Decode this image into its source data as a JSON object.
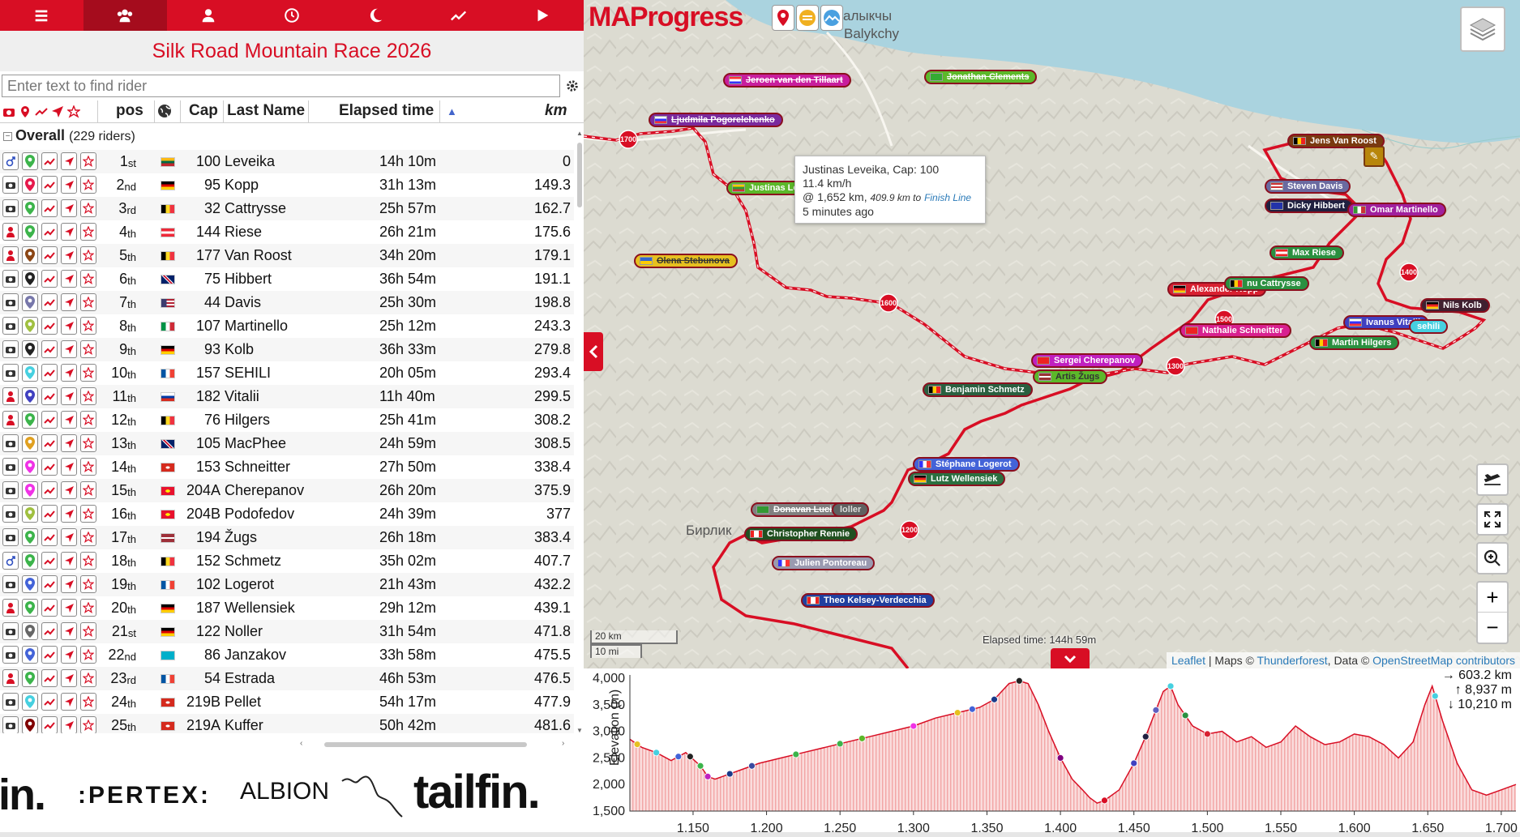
{
  "app": {
    "title": "Silk Road Mountain Race 2026",
    "logo": "MAProgress",
    "accent_color": "#d80e24"
  },
  "nav": [
    {
      "icon": "menu-icon",
      "active": false
    },
    {
      "icon": "group-icon",
      "active": true
    },
    {
      "icon": "user-icon",
      "active": false
    },
    {
      "icon": "clock-icon",
      "active": false
    },
    {
      "icon": "moon-icon",
      "active": false
    },
    {
      "icon": "chart-line-icon",
      "active": false
    },
    {
      "icon": "play-icon",
      "active": false
    }
  ],
  "search": {
    "placeholder": "Enter text to find rider"
  },
  "table": {
    "headers": {
      "pos": "pos",
      "cap": "Cap",
      "last_name": "Last Name",
      "elapsed": "Elapsed time",
      "km": "km"
    },
    "group": {
      "label": "Overall",
      "count": "(229 riders)"
    },
    "rows": [
      {
        "pos": "1",
        "suf": "st",
        "cap": "100",
        "name": "Leveika",
        "elapsed": "14h 10m",
        "km": "0",
        "flag": "lt",
        "type": "bike",
        "pin": "#3cb44b"
      },
      {
        "pos": "2",
        "suf": "nd",
        "cap": "95",
        "name": "Kopp",
        "elapsed": "31h 13m",
        "km": "149.3",
        "flag": "de",
        "type": "camera",
        "pin": "#e6194b"
      },
      {
        "pos": "3",
        "suf": "rd",
        "cap": "32",
        "name": "Cattrysse",
        "elapsed": "25h 57m",
        "km": "162.7",
        "flag": "be",
        "type": "camera",
        "pin": "#3cb44b"
      },
      {
        "pos": "4",
        "suf": "th",
        "cap": "144",
        "name": "Riese",
        "elapsed": "26h 21m",
        "km": "175.6",
        "flag": "at",
        "type": "person",
        "pin": "#3cb44b"
      },
      {
        "pos": "5",
        "suf": "th",
        "cap": "177",
        "name": "Van Roost",
        "elapsed": "34h 20m",
        "km": "179.1",
        "flag": "be",
        "type": "person",
        "pin": "#8b4513"
      },
      {
        "pos": "6",
        "suf": "th",
        "cap": "75",
        "name": "Hibbert",
        "elapsed": "36h 54m",
        "km": "191.1",
        "flag": "gb",
        "type": "camera",
        "pin": "#222222"
      },
      {
        "pos": "7",
        "suf": "th",
        "cap": "44",
        "name": "Davis",
        "elapsed": "25h 30m",
        "km": "198.8",
        "flag": "us",
        "type": "camera",
        "pin": "#7777aa"
      },
      {
        "pos": "8",
        "suf": "th",
        "cap": "107",
        "name": "Martinello",
        "elapsed": "25h 12m",
        "km": "243.3",
        "flag": "it",
        "type": "camera",
        "pin": "#a0c040"
      },
      {
        "pos": "9",
        "suf": "th",
        "cap": "93",
        "name": "Kolb",
        "elapsed": "36h 33m",
        "km": "279.8",
        "flag": "de",
        "type": "camera",
        "pin": "#222222"
      },
      {
        "pos": "10",
        "suf": "th",
        "cap": "157",
        "name": "SEHILI",
        "elapsed": "20h 05m",
        "km": "293.4",
        "flag": "fr",
        "type": "camera",
        "pin": "#46d0e0"
      },
      {
        "pos": "11",
        "suf": "th",
        "cap": "182",
        "name": "Vitalii",
        "elapsed": "11h 40m",
        "km": "299.5",
        "flag": "ru",
        "type": "person",
        "pin": "#4040c0"
      },
      {
        "pos": "12",
        "suf": "th",
        "cap": "76",
        "name": "Hilgers",
        "elapsed": "25h 41m",
        "km": "308.2",
        "flag": "be",
        "type": "person",
        "pin": "#3cb44b"
      },
      {
        "pos": "13",
        "suf": "th",
        "cap": "105",
        "name": "MacPhee",
        "elapsed": "24h 59m",
        "km": "308.5",
        "flag": "gb",
        "type": "camera",
        "pin": "#e0a020"
      },
      {
        "pos": "14",
        "suf": "th",
        "cap": "153",
        "name": "Schneitter",
        "elapsed": "27h 50m",
        "km": "338.4",
        "flag": "ch",
        "type": "camera",
        "pin": "#f032e6"
      },
      {
        "pos": "15",
        "suf": "th",
        "cap": "204A",
        "name": "Cherepanov",
        "elapsed": "26h 20m",
        "km": "375.9",
        "flag": "kg",
        "type": "camera",
        "pin": "#f032e6"
      },
      {
        "pos": "16",
        "suf": "th",
        "cap": "204B",
        "name": "Podofedov",
        "elapsed": "24h 39m",
        "km": "377",
        "flag": "kg",
        "type": "camera",
        "pin": "#a0c040"
      },
      {
        "pos": "17",
        "suf": "th",
        "cap": "194",
        "name": "Žugs",
        "elapsed": "26h 18m",
        "km": "383.4",
        "flag": "lv",
        "type": "camera",
        "pin": "#3cb44b"
      },
      {
        "pos": "18",
        "suf": "th",
        "cap": "152",
        "name": "Schmetz",
        "elapsed": "35h 02m",
        "km": "407.7",
        "flag": "be",
        "type": "bike",
        "pin": "#3cb44b"
      },
      {
        "pos": "19",
        "suf": "th",
        "cap": "102",
        "name": "Logerot",
        "elapsed": "21h 43m",
        "km": "432.2",
        "flag": "fr",
        "type": "camera",
        "pin": "#4363d8"
      },
      {
        "pos": "20",
        "suf": "th",
        "cap": "187",
        "name": "Wellensiek",
        "elapsed": "29h 12m",
        "km": "439.1",
        "flag": "de",
        "type": "person",
        "pin": "#3cb44b"
      },
      {
        "pos": "21",
        "suf": "st",
        "cap": "122",
        "name": "Noller",
        "elapsed": "31h 54m",
        "km": "471.8",
        "flag": "de",
        "type": "camera",
        "pin": "#666666"
      },
      {
        "pos": "22",
        "suf": "nd",
        "cap": "86",
        "name": "Janzakov",
        "elapsed": "33h 58m",
        "km": "475.5",
        "flag": "kz",
        "type": "camera",
        "pin": "#4363d8"
      },
      {
        "pos": "23",
        "suf": "rd",
        "cap": "54",
        "name": "Estrada",
        "elapsed": "46h 53m",
        "km": "476.5",
        "flag": "fr",
        "type": "person",
        "pin": "#3cb44b"
      },
      {
        "pos": "24",
        "suf": "th",
        "cap": "219B",
        "name": "Pellet",
        "elapsed": "54h 17m",
        "km": "477.9",
        "flag": "ch",
        "type": "camera",
        "pin": "#46d0e0"
      },
      {
        "pos": "25",
        "suf": "th",
        "cap": "219A",
        "name": "Kuffer",
        "elapsed": "50h 42m",
        "km": "481.6",
        "flag": "ch",
        "type": "camera",
        "pin": "#800000"
      }
    ]
  },
  "sponsors": [
    "in.",
    ":PERTEX:",
    "ALBION",
    "tailfin."
  ],
  "map": {
    "towns": [
      {
        "name": "Balykchy",
        "sub": "алыкчы"
      },
      {
        "name": "Бирлик"
      }
    ],
    "riders": [
      {
        "name": "Jeroen van den Tillaart",
        "color": "#c81e9e"
      },
      {
        "name": "Jonathan Clements",
        "color": "#5cb82a"
      },
      {
        "name": "Ljudmila Pogorelchenko",
        "color": "#7a2a9e"
      },
      {
        "name": "Justinas Le",
        "color": "#5cb82a"
      },
      {
        "name": "Olena Stebunova",
        "color": "#e6c020"
      },
      {
        "name": "Jens Van Roost",
        "color": "#7a3a10"
      },
      {
        "name": "Steven Davis",
        "color": "#6a6aa0"
      },
      {
        "name": "Dicky Hibbert",
        "color": "#202040"
      },
      {
        "name": "Omar Martinello",
        "color": "#a0209e"
      },
      {
        "name": "Max Riese",
        "color": "#2a9040"
      },
      {
        "name": "Alexander Kopp",
        "color": "#d82030"
      },
      {
        "name": "nu Cattrysse",
        "color": "#2a9040"
      },
      {
        "name": "Nathalie Schneitter",
        "color": "#d82090"
      },
      {
        "name": "Nils Kolb",
        "color": "#402030"
      },
      {
        "name": "Ivanus Vitalii",
        "color": "#4040c0"
      },
      {
        "name": "sehili",
        "color": "#46d0e0"
      },
      {
        "name": "Martin Hilgers",
        "color": "#2a9040"
      },
      {
        "name": "Sergei Cherepanov",
        "color": "#c020c0"
      },
      {
        "name": "Artis Žugs",
        "color": "#5cb82a"
      },
      {
        "name": "Benjamin Schmetz",
        "color": "#2a6040"
      },
      {
        "name": "Stéphane Logerot",
        "color": "#4363d8"
      },
      {
        "name": "Lutz Wellensiek",
        "color": "#2a7040"
      },
      {
        "name": "Donavan Lucio",
        "color": "#808080"
      },
      {
        "name": "loller",
        "color": "#606060"
      },
      {
        "name": "Christopher Rennie",
        "color": "#205020"
      },
      {
        "name": "Julien Pontoreau",
        "color": "#9a9ab0"
      },
      {
        "name": "Theo Kelsey-Verdecchia",
        "color": "#2040a0"
      }
    ],
    "km_markers": [
      "1700",
      "1600",
      "1500",
      "1400",
      "1300",
      "1200"
    ],
    "popup": {
      "line1": "Justinas Leveika, Cap: 100",
      "line2": "11.4 km/h",
      "line3a": "@ 1,652 km,",
      "line3b": "409.9 km to",
      "line3link": "Finish Line",
      "line4": "5 minutes ago"
    },
    "scale": {
      "km": "20 km",
      "mi": "10 mi"
    },
    "elapsed": "Elapsed time: 144h 59m",
    "attribution": {
      "leaflet": "Leaflet",
      "maps": " | Maps © ",
      "thunder": "Thunderforest",
      "data": ", Data © ",
      "osm": "OpenStreetMap contributors"
    }
  },
  "elevation": {
    "ylabel": "Elevation (m)",
    "stats": {
      "distance": "→ 603.2 km",
      "up": "↑ 8,937 m",
      "down": "↓ 10,210 m"
    },
    "yticks": [
      "4,000",
      "3,500",
      "3,000",
      "2,500",
      "2,000",
      "1,500"
    ],
    "xticks": [
      "1,150",
      "1,200",
      "1,250",
      "1,300",
      "1,350",
      "1,400",
      "1,450",
      "1,500",
      "1,550",
      "1,600",
      "1,650",
      "1,700"
    ]
  },
  "chart_data": {
    "type": "area",
    "xlabel": "",
    "ylabel": "Elevation (m)",
    "xlim": [
      1107,
      1710
    ],
    "ylim": [
      1500,
      4000
    ],
    "x": [
      1107,
      1115,
      1125,
      1135,
      1145,
      1155,
      1160,
      1165,
      1175,
      1185,
      1195,
      1210,
      1225,
      1240,
      1255,
      1270,
      1285,
      1300,
      1315,
      1330,
      1345,
      1355,
      1360,
      1365,
      1372,
      1378,
      1385,
      1392,
      1400,
      1408,
      1415,
      1420,
      1425,
      1430,
      1440,
      1450,
      1458,
      1465,
      1470,
      1475,
      1480,
      1490,
      1500,
      1510,
      1520,
      1530,
      1540,
      1550,
      1560,
      1570,
      1580,
      1590,
      1600,
      1610,
      1620,
      1630,
      1640,
      1648,
      1653,
      1660,
      1670,
      1680,
      1690,
      1700,
      1710
    ],
    "values": [
      2850,
      2700,
      2600,
      2450,
      2600,
      2350,
      2150,
      2100,
      2200,
      2300,
      2400,
      2500,
      2600,
      2700,
      2800,
      2900,
      3000,
      3100,
      3250,
      3350,
      3450,
      3600,
      3750,
      3900,
      3950,
      3900,
      3500,
      3000,
      2500,
      2100,
      1900,
      1750,
      1650,
      1700,
      1900,
      2400,
      2900,
      3400,
      3750,
      3850,
      3500,
      3100,
      2950,
      3000,
      2800,
      2900,
      2700,
      2800,
      3100,
      2900,
      2750,
      2800,
      2950,
      2900,
      2750,
      2500,
      2800,
      3500,
      3850,
      3200,
      2400,
      1900,
      1800,
      1900,
      2000
    ],
    "rider_points_km": [
      1112,
      1125,
      1140,
      1148,
      1155,
      1160,
      1175,
      1190,
      1220,
      1250,
      1265,
      1300,
      1330,
      1340,
      1355,
      1372,
      1400,
      1430,
      1450,
      1458,
      1465,
      1475,
      1485,
      1500,
      1655
    ]
  }
}
